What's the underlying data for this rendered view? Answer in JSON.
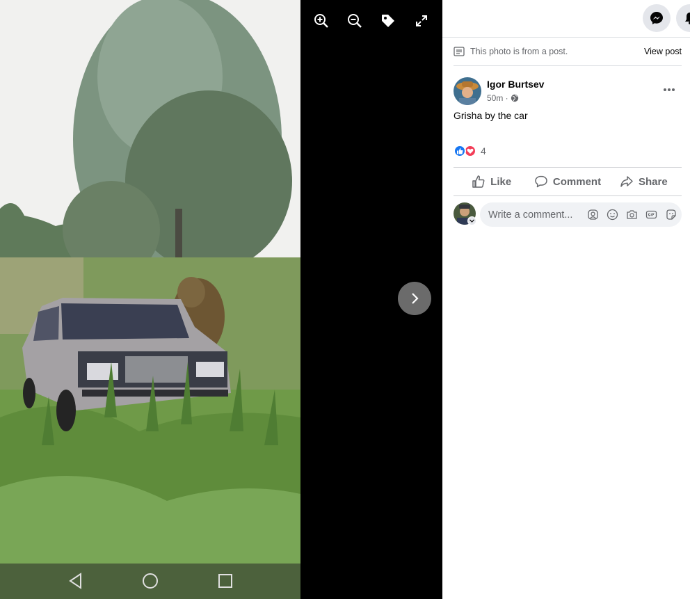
{
  "viewer": {
    "tools": [
      "zoom-in-icon",
      "zoom-out-icon",
      "tag-icon",
      "fullscreen-icon"
    ],
    "next": "chevron-right-icon",
    "android_nav": [
      "back-triangle-icon",
      "home-circle-icon",
      "recents-square-icon"
    ]
  },
  "panel": {
    "notice_text": "This photo is from a post.",
    "view_post": "View post",
    "author": "Igor Burtsev",
    "time": "50m ·",
    "post_text": "Grisha by the car",
    "reaction_count": "4",
    "actions": {
      "like": "Like",
      "comment": "Comment",
      "share": "Share"
    },
    "comment_placeholder": "Write a comment..."
  },
  "colors": {
    "accent": "#1877f2",
    "love": "#f33e58",
    "muted": "#65676b"
  }
}
